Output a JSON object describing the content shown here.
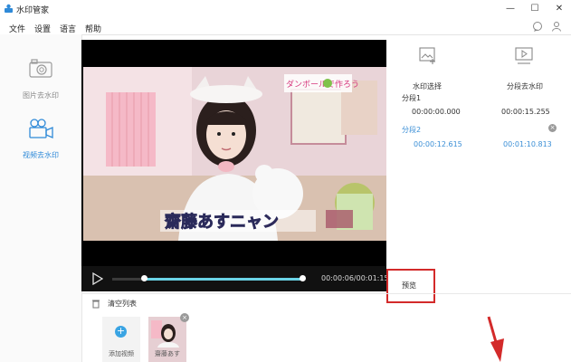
{
  "window": {
    "title": "水印管家"
  },
  "menu": {
    "items": [
      "文件",
      "设置",
      "语言",
      "帮助"
    ]
  },
  "sidebar": {
    "items": [
      {
        "label": "图片去水印",
        "icon": "camera-icon",
        "active": false
      },
      {
        "label": "视频去水印",
        "icon": "video-camera-icon",
        "active": true
      }
    ]
  },
  "video": {
    "time": "00:00:06/00:01:15",
    "progress_start": 0.17,
    "progress_end": 1.0,
    "overlay_text": "齋藤あすニャン",
    "sign_text": "ダンボールで作ろう"
  },
  "right_panel": {
    "tabs": [
      {
        "label": "水印选择",
        "icon": "image-select-icon"
      },
      {
        "label": "分段去水印",
        "icon": "video-segment-icon"
      }
    ],
    "segments": [
      {
        "label": "分段1",
        "start": "00:00:00.000",
        "end": "00:00:15.255",
        "active": false
      },
      {
        "label": "分段2",
        "start": "00:00:12.615",
        "end": "00:01:10.813",
        "active": true
      }
    ]
  },
  "preview_button": {
    "label": "预览"
  },
  "list": {
    "clear_label": "清空列表",
    "add_label": "添加视频",
    "thumb_label": "齋藤あす"
  },
  "colors": {
    "accent": "#3b8fd6",
    "highlight": "#d32a2a",
    "progress": "#6ad3e6"
  }
}
